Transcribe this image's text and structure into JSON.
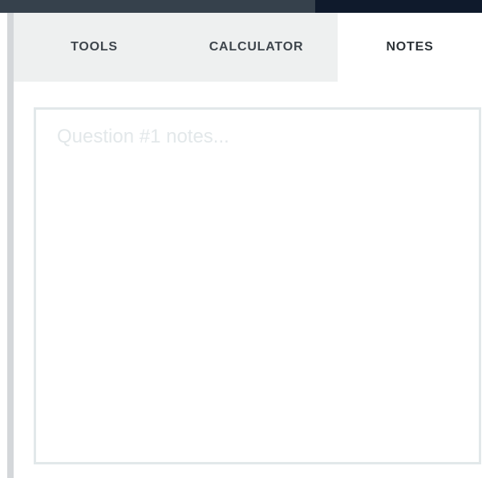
{
  "tabs": [
    {
      "label": "TOOLS",
      "active": false
    },
    {
      "label": "CALCULATOR",
      "active": false
    },
    {
      "label": "NOTES",
      "active": true
    }
  ],
  "notes": {
    "value": "",
    "placeholder": "Question #1 notes..."
  },
  "colors": {
    "header_dark": "#0f1a2c",
    "header_mid": "#36414c",
    "tab_inactive_bg": "#eef0f0",
    "tab_active_bg": "#ffffff",
    "textarea_border": "#e2e8ea"
  }
}
